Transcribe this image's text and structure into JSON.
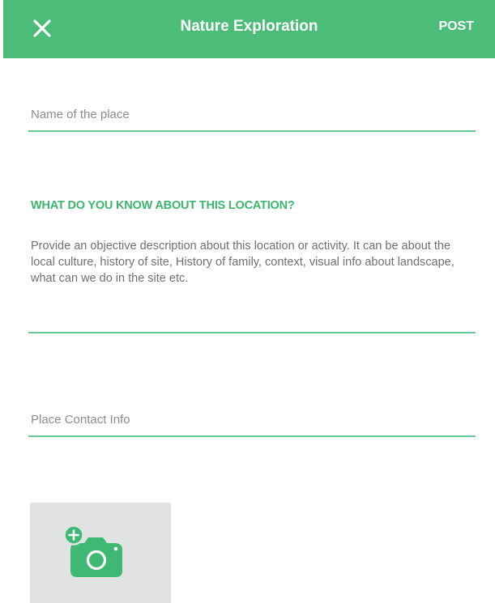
{
  "app_bar": {
    "title": "Nature Exploration",
    "post_label": "POST",
    "close_icon": "close-icon",
    "background": "#4cbd78"
  },
  "form": {
    "place_name": {
      "value": "",
      "placeholder": "Name of the place"
    },
    "location_section_heading": "WHAT DO YOU KNOW ABOUT THIS LOCATION?",
    "description": {
      "value": "",
      "placeholder": "Provide an objective description about this location or activity. It can be about the local culture, history of site, History of family, context, visual info about landscape, what can we do in the site etc."
    },
    "contact_info": {
      "value": "",
      "placeholder": "Place Contact Info"
    },
    "add_photo_icon": "add-photo-camera-icon"
  },
  "colors": {
    "accent": "#4cbd78",
    "heading": "#3db56e",
    "underline": "#66c994",
    "photo_tile": "#e1e3e2"
  }
}
